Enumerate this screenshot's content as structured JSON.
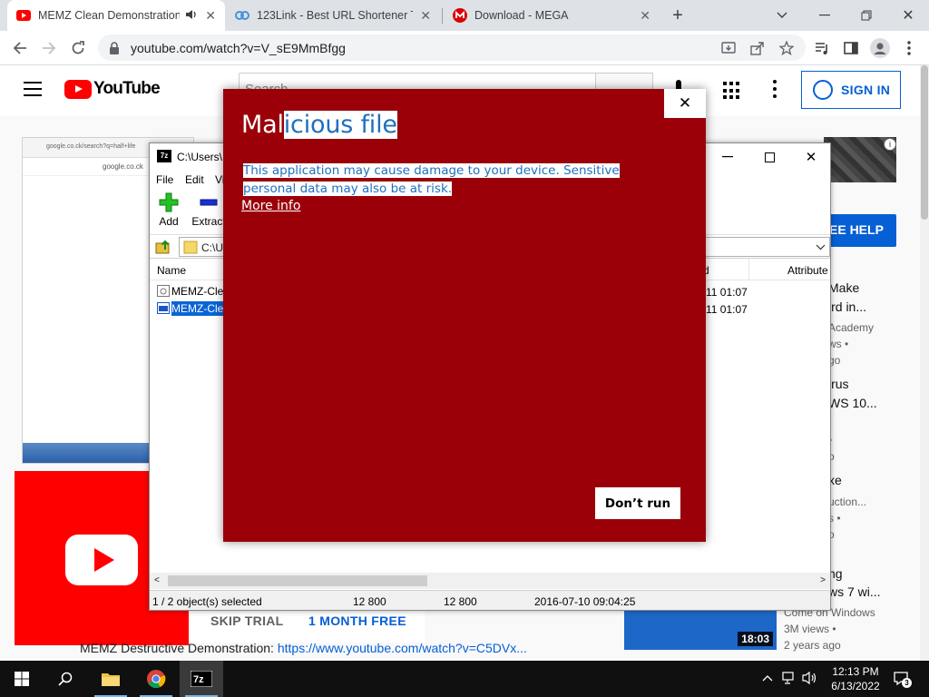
{
  "browser": {
    "tabs": [
      {
        "title": "MEMZ Clean Demonstration",
        "favicon": "youtube-icon",
        "audio": true,
        "active": true
      },
      {
        "title": "123Link - Best URL Shortener To",
        "favicon": "link-icon",
        "active": false
      },
      {
        "title": "Download - MEGA",
        "favicon": "mega-icon",
        "active": false
      }
    ],
    "new_tab": "+",
    "url": "youtube.com/watch?v=V_sE9MmBfgg"
  },
  "youtube": {
    "logo_text": "YouTube",
    "search_placeholder": "Search",
    "sign_in": "SIGN IN",
    "ad": {
      "skip_trial": "SKIP TRIAL",
      "month_free": "1 MONTH FREE"
    },
    "description": {
      "text": "MEMZ Destructive Demonstration: ",
      "link": "https://www.youtube.com/watch?v=C5DVx..."
    },
    "see_help": "EE HELP",
    "sidebar_fragments": {
      "r1_title_a": "Make",
      "r1_title_b": "ird in...",
      "r1_meta_a": "Academy",
      "r1_meta_b": "ws •",
      "r1_meta_c": "go",
      "r2_title_a": "irus",
      "r2_title_b": "WS 10...",
      "r2_meta_a": "•",
      "r2_meta_b": "o",
      "r3_title_a": "xe",
      "r3_meta_a": "uction...",
      "r3_meta_b": "s •",
      "r3_meta_c": "o",
      "r4_title_a": "ng",
      "r4_title_b": "ws 7 wi...",
      "r4_channel": "Come on Windows",
      "r4_views": "3M views •",
      "r4_age": "2 years ago",
      "r4_duration": "18:03"
    },
    "thumb_url_a": "google.co.ck/search?q=half+life",
    "thumb_url_b": "google.co.ck"
  },
  "sevenzip": {
    "title": "C:\\Users\\",
    "menu": [
      "File",
      "Edit",
      "Vi"
    ],
    "tools": [
      "Add",
      "Extract"
    ],
    "path": "C:\\U",
    "columns": {
      "name": "Name",
      "modified": "d",
      "attributes": "Attribute"
    },
    "rows": [
      {
        "name": "MEMZ-Cle",
        "modified": "11 01:07",
        "selected": false
      },
      {
        "name": "MEMZ-Cle",
        "modified": "11 01:07",
        "selected": true
      }
    ],
    "status": {
      "selected": "1 / 2 object(s) selected",
      "size": "12 800",
      "packed": "12 800",
      "date": "2016-07-10 09:04:25"
    }
  },
  "smartscreen": {
    "title_plain": "Mal",
    "title_selected": "icious file",
    "message": "This application may cause damage to your device. Sensitive personal data may also be at risk.",
    "more_info": "More info",
    "dont_run": "Don’t run",
    "close": "✕"
  },
  "taskbar": {
    "time": "12:13 PM",
    "date": "6/13/2022",
    "notifications": "3",
    "apps": [
      "start-icon",
      "search-icon",
      "file-explorer-icon",
      "chrome-icon",
      "7zip-icon"
    ]
  }
}
